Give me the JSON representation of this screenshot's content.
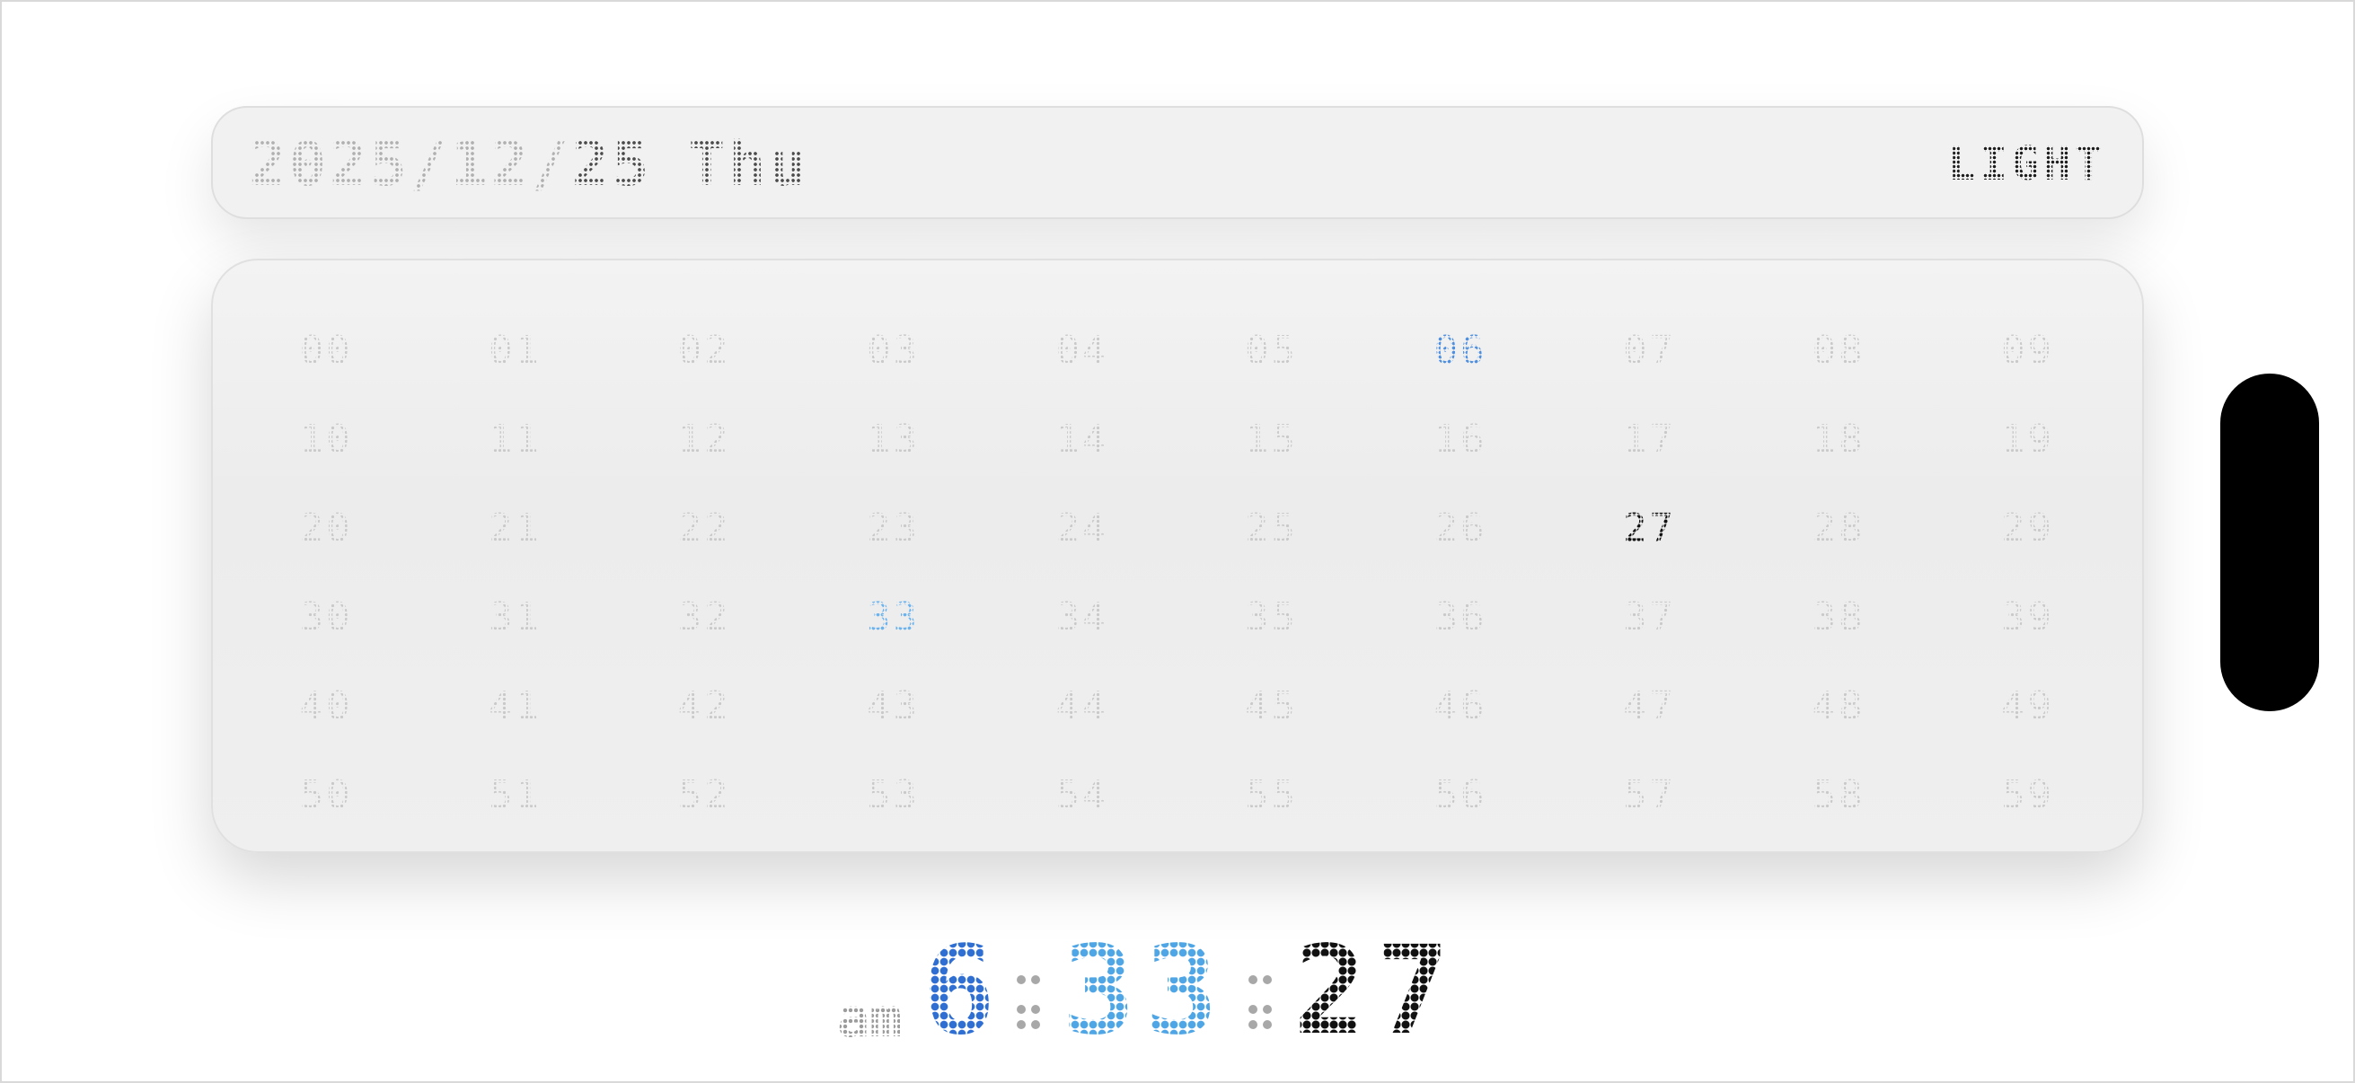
{
  "header": {
    "date_prefix": "2025/12/",
    "date_day": "25",
    "weekday": "Thu",
    "theme_label": "LIGHT"
  },
  "grid": {
    "cells": [
      "00",
      "01",
      "02",
      "03",
      "04",
      "05",
      "06",
      "07",
      "08",
      "09",
      "10",
      "11",
      "12",
      "13",
      "14",
      "15",
      "16",
      "17",
      "18",
      "19",
      "20",
      "21",
      "22",
      "23",
      "24",
      "25",
      "26",
      "27",
      "28",
      "29",
      "30",
      "31",
      "32",
      "33",
      "34",
      "35",
      "36",
      "37",
      "38",
      "39",
      "40",
      "41",
      "42",
      "43",
      "44",
      "45",
      "46",
      "47",
      "48",
      "49",
      "50",
      "51",
      "52",
      "53",
      "54",
      "55",
      "56",
      "57",
      "58",
      "59"
    ],
    "highlight_hour": "06",
    "highlight_minute": "33",
    "highlight_second": "27"
  },
  "clock": {
    "ampm": "am",
    "hour": "6",
    "minute": "33",
    "second": "27"
  },
  "colors": {
    "hour": "#2f6fd4",
    "minute": "#4fa6e6",
    "second": "#111111",
    "background": "#ffffff",
    "panel": "#efefef"
  }
}
